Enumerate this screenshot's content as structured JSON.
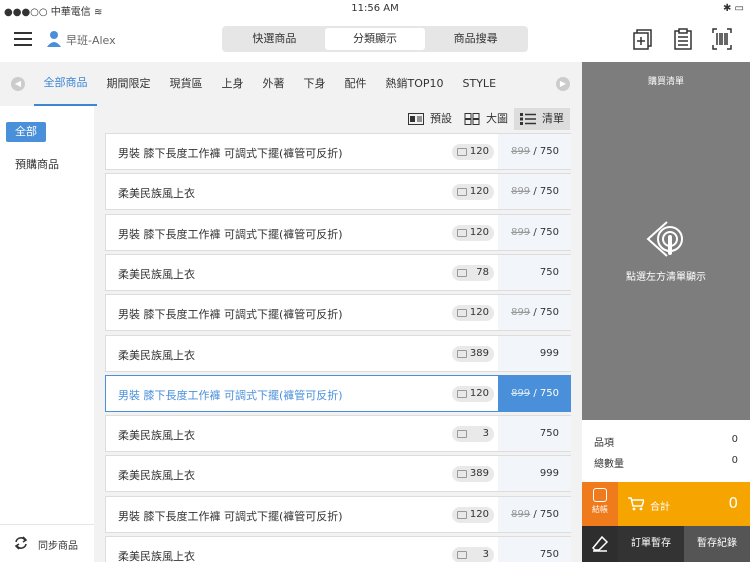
{
  "status": {
    "left": "●●●○○ 中華電信 ︎≋",
    "time": "11:56 AM",
    "right": "✱ ▭"
  },
  "header": {
    "user_name": "早班-Alex",
    "tabs": [
      {
        "label": "快選商品"
      },
      {
        "label": "分類顯示"
      },
      {
        "label": "商品搜尋"
      }
    ]
  },
  "categories": [
    "全部商品",
    "期間限定",
    "現貨區",
    "上身",
    "外著",
    "下身",
    "配件",
    "熱銷TOP10",
    "STYLE"
  ],
  "sidebar": {
    "all_label": "全部",
    "pre_order_label": "預購商品",
    "sync_label": "同步商品"
  },
  "views": {
    "default_label": "預設",
    "large_label": "大圖",
    "list_label": "清單"
  },
  "products": [
    {
      "name": "男裝 膝下長度工作褲 可調式下擺(褲管可反折)",
      "stock": "120",
      "orig_price": "899",
      "sep": " / ",
      "price": "750"
    },
    {
      "name": "柔美民族風上衣",
      "stock": "120",
      "orig_price": "899",
      "sep": " / ",
      "price": "750"
    },
    {
      "name": "男裝 膝下長度工作褲 可調式下擺(褲管可反折)",
      "stock": "120",
      "orig_price": "899",
      "sep": " / ",
      "price": "750"
    },
    {
      "name": "柔美民族風上衣",
      "stock": "78",
      "orig_price": "",
      "sep": "",
      "price": "750"
    },
    {
      "name": "男裝 膝下長度工作褲 可調式下擺(褲管可反折)",
      "stock": "120",
      "orig_price": "899",
      "sep": " / ",
      "price": "750"
    },
    {
      "name": "柔美民族風上衣",
      "stock": "389",
      "orig_price": "",
      "sep": "",
      "price": "999"
    },
    {
      "name": "男裝 膝下長度工作褲 可調式下擺(褲管可反折)",
      "stock": "120",
      "orig_price": "899",
      "sep": " / ",
      "price": "750",
      "selected": true
    },
    {
      "name": "柔美民族風上衣",
      "stock": "3",
      "orig_price": "",
      "sep": "",
      "price": "750"
    },
    {
      "name": "柔美民族風上衣",
      "stock": "389",
      "orig_price": "",
      "sep": "",
      "price": "999"
    },
    {
      "name": "男裝 膝下長度工作褲 可調式下擺(褲管可反折)",
      "stock": "120",
      "orig_price": "899",
      "sep": " / ",
      "price": "750"
    },
    {
      "name": "柔美民族風上衣",
      "stock": "3",
      "orig_price": "",
      "sep": "",
      "price": "750"
    }
  ],
  "cart": {
    "title": "購買清單",
    "hint": "點選左方清單顯示",
    "items_label": "品項",
    "items_value": "0",
    "qty_label": "總數量",
    "qty_value": "0",
    "checkout_label": "結帳",
    "total_label": "合計",
    "total_value": "0",
    "hold_label": "訂單暫存",
    "history_label": "暫存紀錄"
  },
  "colors": {
    "accent": "#4a8fd9",
    "total_bar": "#f5a400",
    "checkout": "#f07b1c",
    "cart_bg": "#7d7d7d"
  }
}
